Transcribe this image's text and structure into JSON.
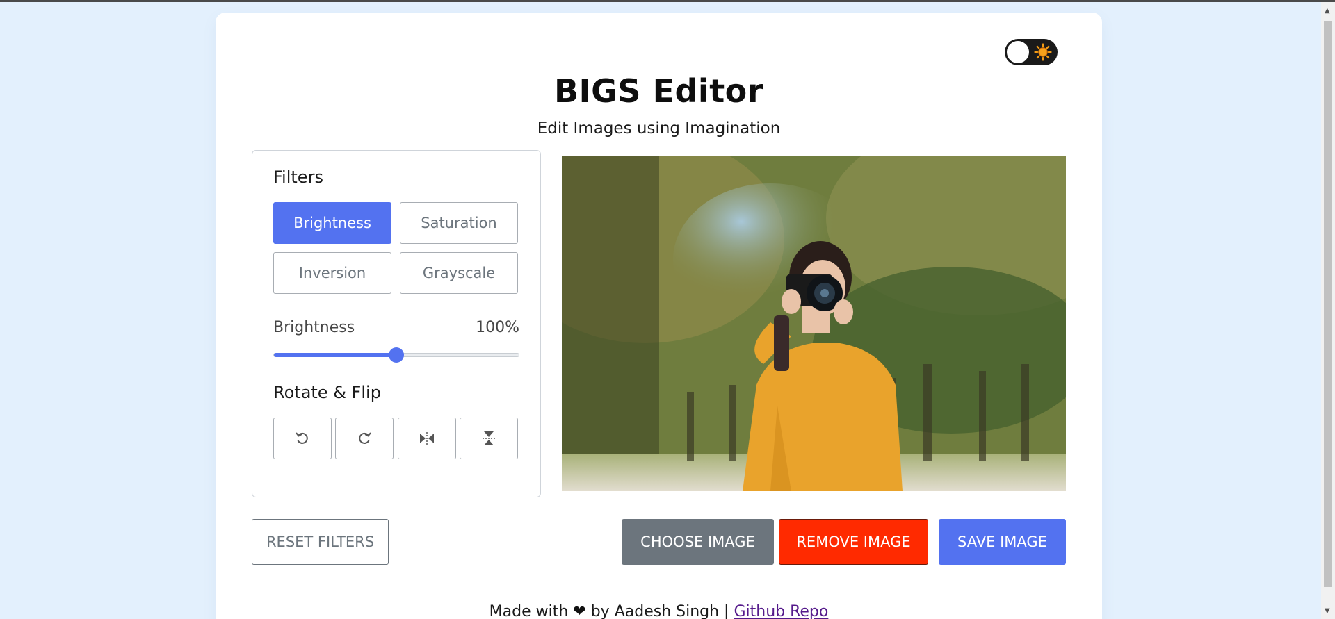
{
  "app": {
    "title": "BIGS Editor",
    "subtitle": "Edit Images using Imagination"
  },
  "filters": {
    "heading": "Filters",
    "buttons": [
      {
        "label": "Brightness",
        "active": true
      },
      {
        "label": "Saturation",
        "active": false
      },
      {
        "label": "Inversion",
        "active": false
      },
      {
        "label": "Grayscale",
        "active": false
      }
    ],
    "slider": {
      "label": "Brightness",
      "value_text": "100%",
      "value": 100,
      "max": 200
    }
  },
  "rotate": {
    "heading": "Rotate & Flip",
    "buttons": [
      "rotate-left-icon",
      "rotate-right-icon",
      "flip-horizontal-icon",
      "flip-vertical-icon"
    ]
  },
  "actions": {
    "reset": "RESET FILTERS",
    "choose": "CHOOSE IMAGE",
    "remove": "REMOVE IMAGE",
    "save": "SAVE IMAGE"
  },
  "footer": {
    "made_with": "Made with",
    "by": "by Aadesh Singh |",
    "link": "Github Repo"
  },
  "colors": {
    "accent": "#5372f0",
    "danger": "#ff2a00",
    "secondary": "#6c757d",
    "background": "#e3f0fd"
  },
  "theme_toggle": {
    "icon": "sun-icon",
    "state": "light"
  }
}
